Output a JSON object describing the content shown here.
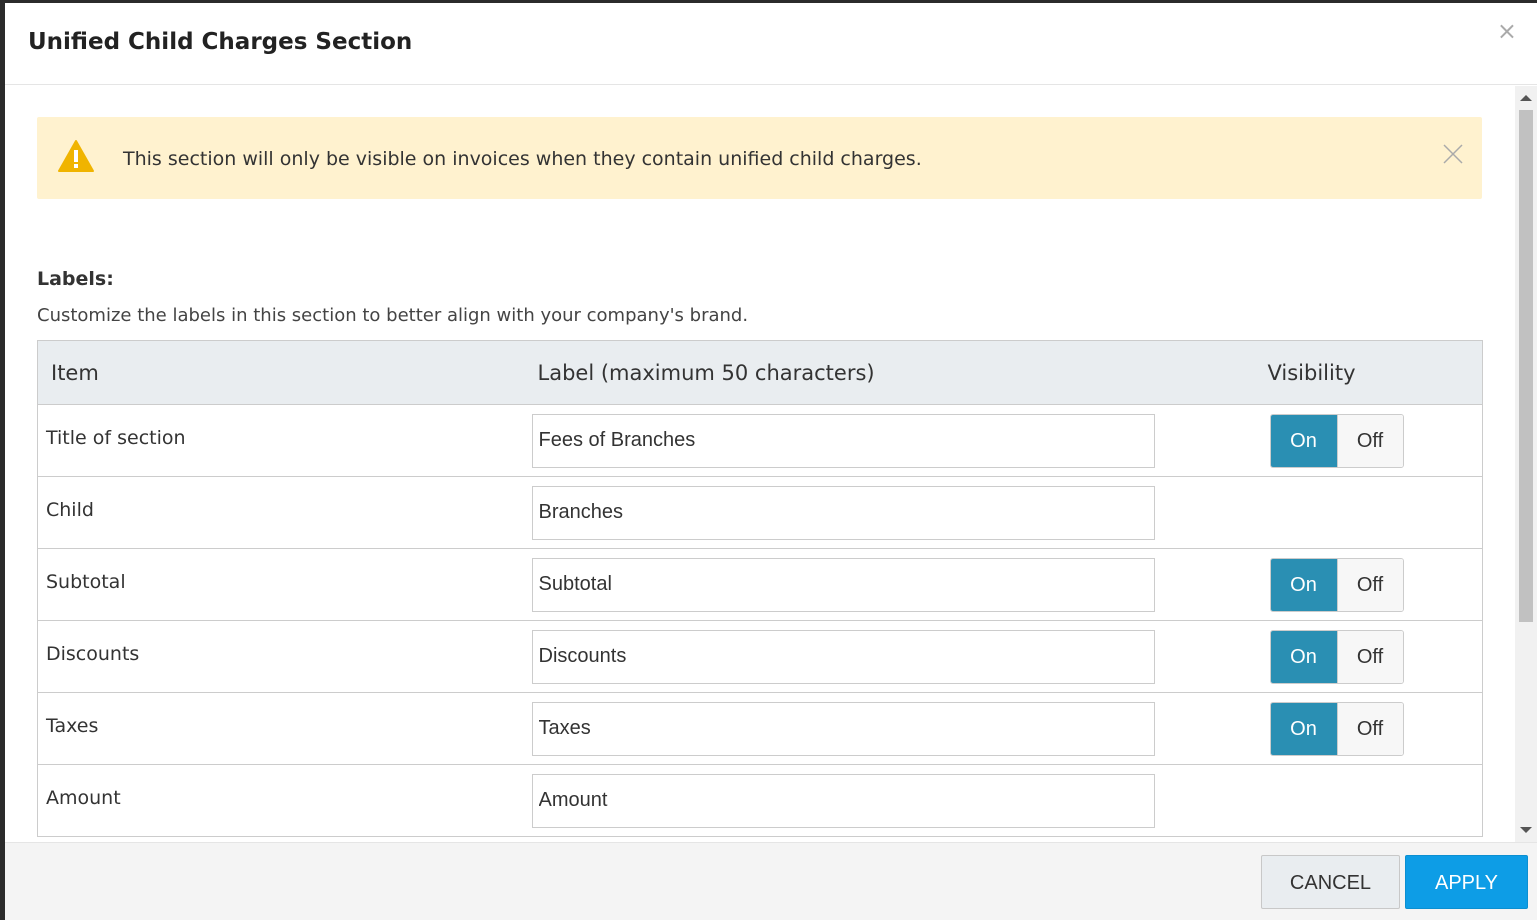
{
  "modal": {
    "title": "Unified Child Charges Section",
    "close_glyph": "×"
  },
  "alert": {
    "icon": "warning-icon",
    "text": "This section will only be visible on invoices when they contain unified child charges.",
    "color": "#fff2cf"
  },
  "section": {
    "title": "Labels:",
    "description": "Customize the labels in this section to better align with your company's brand."
  },
  "table": {
    "headers": {
      "item": "Item",
      "label": "Label (maximum 50 characters)",
      "visibility": "Visibility"
    },
    "rows": [
      {
        "item": "Title of section",
        "value": "Fees of Branches",
        "has_toggle": true,
        "on": "On",
        "off": "Off"
      },
      {
        "item": "Child",
        "value": "Branches",
        "has_toggle": false
      },
      {
        "item": "Subtotal",
        "value": "Subtotal",
        "has_toggle": true,
        "on": "On",
        "off": "Off"
      },
      {
        "item": "Discounts",
        "value": "Discounts",
        "has_toggle": true,
        "on": "On",
        "off": "Off"
      },
      {
        "item": "Taxes",
        "value": "Taxes",
        "has_toggle": true,
        "on": "On",
        "off": "Off"
      },
      {
        "item": "Amount",
        "value": "Amount",
        "has_toggle": false
      }
    ]
  },
  "footer": {
    "cancel_label": "CANCEL",
    "apply_label": "APPLY"
  },
  "colors": {
    "toggle_on": "#2a8fb3",
    "apply_button": "#0d9de6"
  }
}
